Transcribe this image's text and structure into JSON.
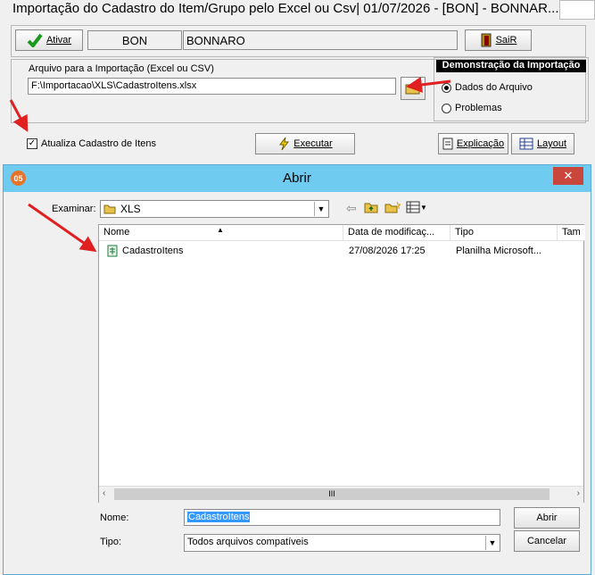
{
  "main_window": {
    "title": "Importação do Cadastro do Item/Grupo pelo Excel ou Csv|  01/07/2026 - [BON] - BONNAR...",
    "ativar_label": "Ativar",
    "company_code": "BON",
    "company_name": "BONNARO",
    "sair_label": "SaiR",
    "file_label": "Arquivo para a Importação (Excel ou CSV)",
    "file_path": "F:\\Importacao\\XLS\\CadastroItens.xlsx",
    "demo_title": "Demonstração da Importação",
    "radio_dados": "Dados do Arquivo",
    "radio_problemas": "Problemas",
    "checkbox_label": "Atualiza Cadastro de Itens",
    "executar_label": "Executar",
    "explicacao_label": "Explicação",
    "layout_label": "Layout"
  },
  "dialog": {
    "title": "Abrir",
    "close_glyph": "✕",
    "examinar_label": "Examinar:",
    "folder": "XLS",
    "columns": [
      "Nome",
      "Data de modificaç...",
      "Tipo",
      "Tam"
    ],
    "files": [
      {
        "name": "CadastroItens",
        "date": "27/08/2026 17:25",
        "type": "Planilha Microsoft..."
      }
    ],
    "scroll_thumb": "III",
    "nome_label": "Nome:",
    "nome_value": "CadastroItens",
    "tipo_label": "Tipo:",
    "tipo_value": "Todos arquivos compatíveis",
    "abrir_label": "Abrir",
    "cancelar_label": "Cancelar",
    "app_badge": "05"
  },
  "colors": {
    "dialog_title_bg": "#6fcbf0",
    "close_red": "#c9463d",
    "arrow_red": "#e02020",
    "selection_blue": "#3399ff"
  }
}
